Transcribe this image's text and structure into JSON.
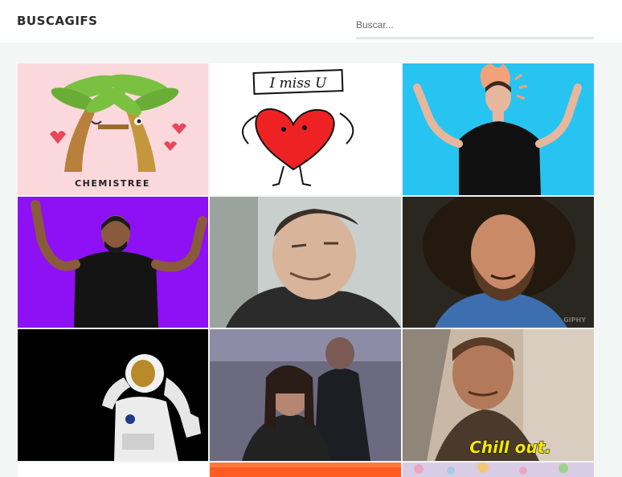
{
  "header": {
    "logo": "BUSCAGIFS",
    "search_placeholder": "Buscar..."
  },
  "gifs": [
    {
      "name": "gif-chemistree",
      "caption": "CHEMISTREE",
      "bg": "#fbd8dc"
    },
    {
      "name": "gif-i-miss-u",
      "caption": "I miss U",
      "bg": "#ffffff"
    },
    {
      "name": "gif-mind-blown-blue",
      "bg": "#27c4f2"
    },
    {
      "name": "gif-hands-up-purple",
      "bg": "#8e10f5"
    },
    {
      "name": "gif-man-grimace",
      "bg": "#8a8f8c"
    },
    {
      "name": "gif-bearded-man",
      "watermark": "GIPHY",
      "bg": "#2a2620"
    },
    {
      "name": "gif-astronaut",
      "bg": "#000000"
    },
    {
      "name": "gif-wrestlers",
      "bg": "#6c6a80"
    },
    {
      "name": "gif-chill-out",
      "caption": "Chill out.",
      "bg": "#a49a8c"
    },
    {
      "name": "gif-partial-white",
      "bg": "#ffffff"
    },
    {
      "name": "gif-partial-red",
      "bg": "#ff5b22"
    },
    {
      "name": "gif-partial-floral",
      "bg": "#d9cde6"
    }
  ]
}
